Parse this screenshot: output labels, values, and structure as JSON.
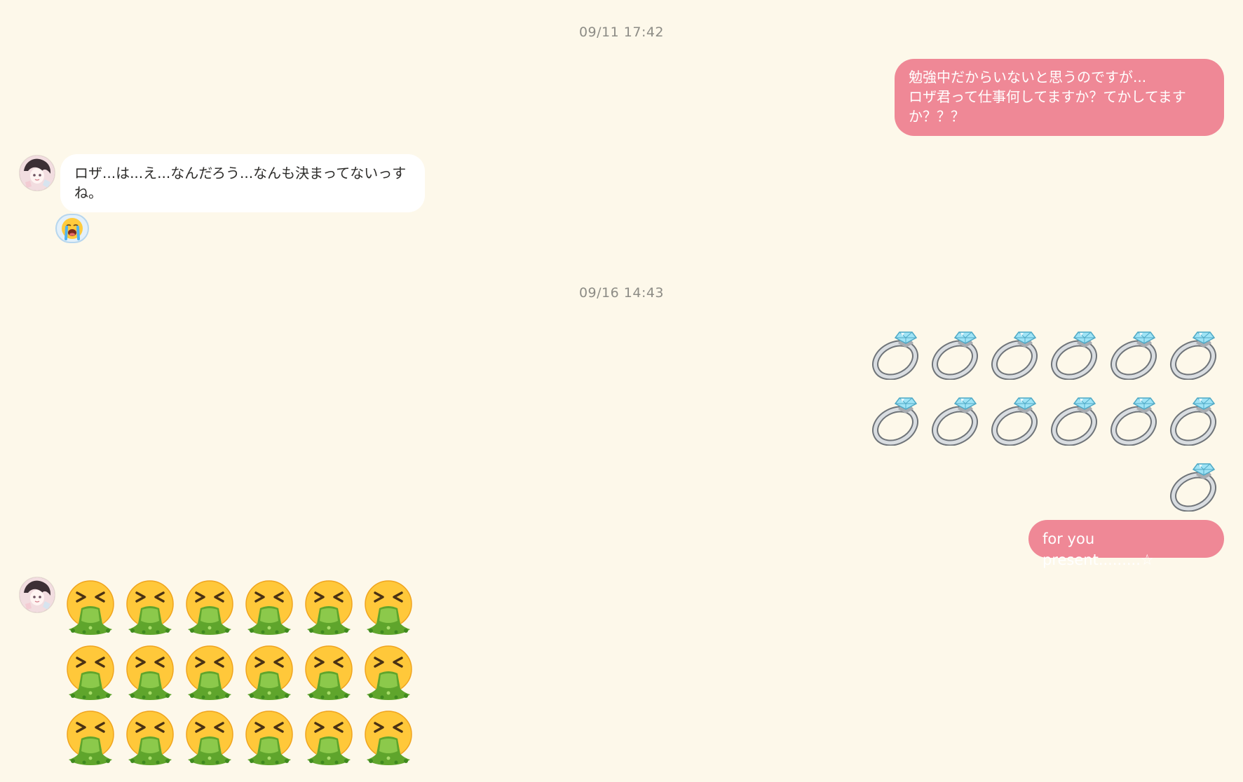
{
  "messages": {
    "timestamp_1": "09/11 17:42",
    "timestamp_2": "09/16 14:43",
    "outgoing_1": "勉強中だからいないと思うのですが...\nロザ君って仕事何してますか？てかしてますか？？？",
    "incoming_1": "ロザ...は...え...なんだろう...なんも決まってないっすね。",
    "reaction_1": "loudly-crying-face",
    "outgoing_2_emoji": "ring",
    "outgoing_2_emoji_count": 13,
    "outgoing_3": "for you present.........☆",
    "incoming_2_emoji": "vomiting-face",
    "incoming_2_emoji_count_visible": 18
  },
  "colors": {
    "background": "#fdf8ea",
    "outgoing_bubble": "#ef8896",
    "incoming_bubble": "#ffffff",
    "timestamp_text": "#8d8c86"
  }
}
